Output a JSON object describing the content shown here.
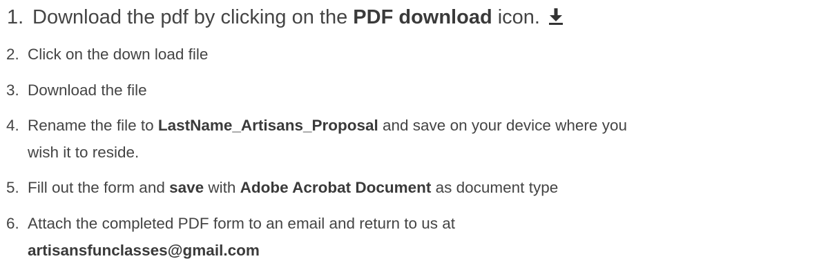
{
  "steps": [
    {
      "number": "1.",
      "parts": [
        "Download the pdf by clicking on the ",
        "PDF download",
        " icon."
      ],
      "icon": "download-icon"
    },
    {
      "number": "2.",
      "parts": [
        "Click on the down load file"
      ]
    },
    {
      "number": "3.",
      "parts": [
        "Download the file"
      ]
    },
    {
      "number": "4.",
      "parts": [
        "Rename the file to ",
        "LastName_Artisans_Proposal",
        " and save on your device where you"
      ],
      "continuation": "wish it to reside."
    },
    {
      "number": "5.",
      "parts": [
        "Fill out the form and ",
        "save",
        " with ",
        "Adobe Acrobat Document",
        " as document type"
      ]
    },
    {
      "number": "6.",
      "parts": [
        "Attach the completed PDF form to an email and return to us at"
      ],
      "continuation": "artisansfunclasses@gmail.com"
    }
  ]
}
